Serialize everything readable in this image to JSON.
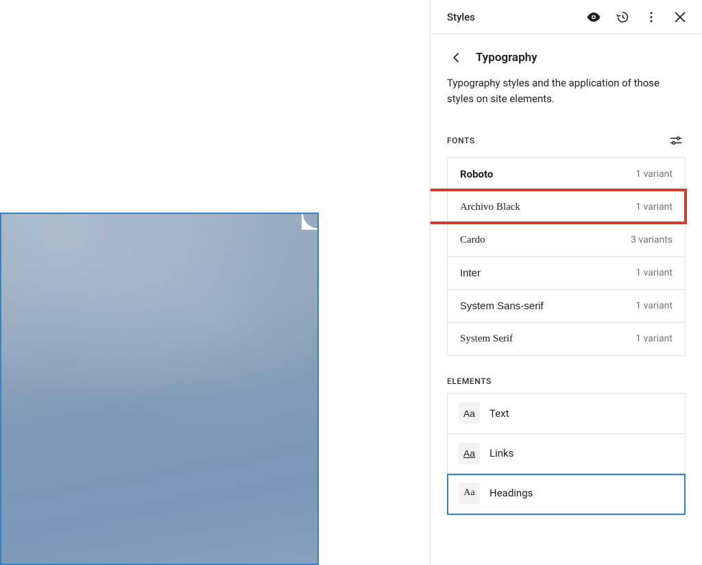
{
  "header": {
    "title": "Styles"
  },
  "panel": {
    "breadcrumb": "Typography",
    "description": "Typography styles and the application of those styles on site elements."
  },
  "sections": {
    "fonts": {
      "label": "FONTS",
      "items": [
        {
          "name": "Roboto",
          "variants": "1 variant",
          "style": "font-ff-sans"
        },
        {
          "name": "Archivo Black",
          "variants": "1 variant",
          "style": "font-ff-serif"
        },
        {
          "name": "Cardo",
          "variants": "3 variants",
          "style": "font-ff-serif"
        },
        {
          "name": "Inter",
          "variants": "1 variant",
          "style": "font-ff-system"
        },
        {
          "name": "System Sans-serif",
          "variants": "1 variant",
          "style": "font-ff-system"
        },
        {
          "name": "System Serif",
          "variants": "1 variant",
          "style": "font-ff-serif"
        }
      ],
      "highlighted_index": 1
    },
    "elements": {
      "label": "ELEMENTS",
      "items": [
        {
          "label": "Text",
          "swatch": "Aa",
          "variant": "plain"
        },
        {
          "label": "Links",
          "swatch": "Aa",
          "variant": "links"
        },
        {
          "label": "Headings",
          "swatch": "Aa",
          "variant": "headings"
        }
      ],
      "selected_index": 2
    }
  }
}
